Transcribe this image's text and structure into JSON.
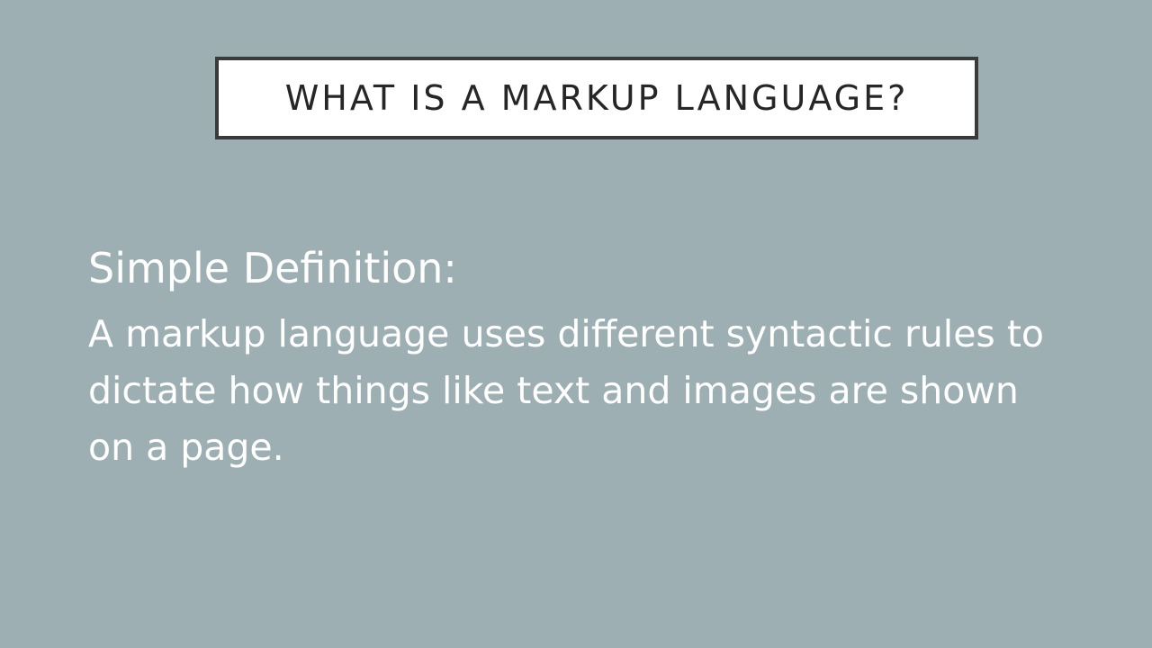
{
  "slide": {
    "title": "WHAT IS A MARKUP LANGUAGE?",
    "subheading": "Simple Definition:",
    "definition": "A markup language uses different syntactic rules to dictate how things like text and images are shown on a page.",
    "colors": {
      "background": "#9eafb4",
      "title_box_fill": "#ffffff",
      "title_box_border": "#3a3a3a",
      "title_text": "#262626",
      "body_text": "#ffffff"
    }
  }
}
